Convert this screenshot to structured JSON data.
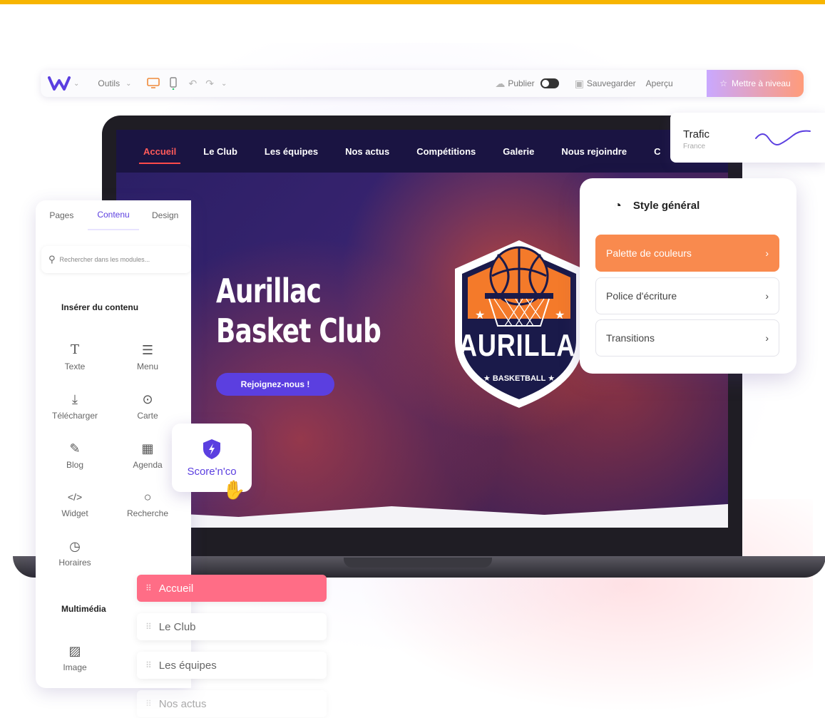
{
  "toolbar": {
    "tools_label": "Outils",
    "publish_label": "Publier",
    "save_label": "Sauvegarder",
    "preview_label": "Aperçu",
    "upgrade_label": "Mettre à niveau"
  },
  "site": {
    "nav": [
      "Accueil",
      "Le Club",
      "Les équipes",
      "Nos actus",
      "Compétitions",
      "Galerie",
      "Nous rejoindre",
      "C"
    ],
    "hero_line1": "Aurillac",
    "hero_line2": "Basket Club",
    "cta": "Rejoignez-nous !",
    "crest_name": "AURILLA",
    "crest_sub": "★ BASKETBALL ★"
  },
  "trafic": {
    "title": "Trafic",
    "subtitle": "France"
  },
  "style_panel": {
    "title": "Style général",
    "rows": [
      "Palette de couleurs",
      "Police d'écriture",
      "Transitions"
    ]
  },
  "left_panel": {
    "tabs": [
      "Pages",
      "Contenu",
      "Design"
    ],
    "search_placeholder": "Rechercher dans les modules...",
    "insert_heading": "Insérer du contenu",
    "modules": [
      "Texte",
      "Menu",
      "Télécharger",
      "Carte",
      "Blog",
      "Agenda",
      "Widget",
      "Recherche",
      "Horaires"
    ],
    "multimedia_heading": "Multimédia",
    "image_label": "Image"
  },
  "scoreco": {
    "label": "Score'n'co"
  },
  "pages_list": [
    "Accueil",
    "Le Club",
    "Les équipes",
    "Nos actus"
  ],
  "colors": {
    "accent": "#5b3fe0",
    "orange": "#f98a4e",
    "pink": "#ff6d86",
    "yellow_stripe": "#f7b500"
  }
}
